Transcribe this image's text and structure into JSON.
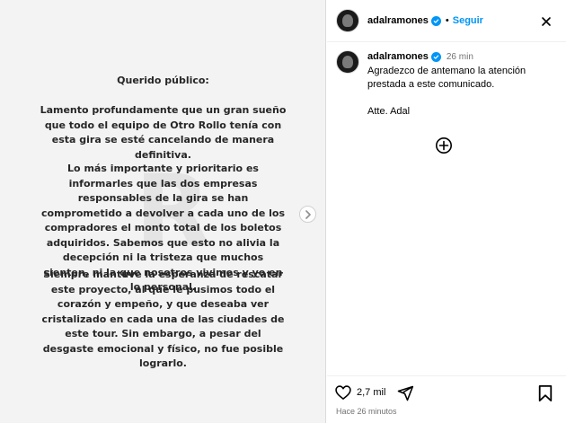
{
  "post": {
    "letter": {
      "greeting": "Querido público:",
      "paragraph1": "Lamento profundamente que un gran sueño que todo el equipo de Otro Rollo tenía con esta gira se esté cancelando de manera definitiva.",
      "paragraph2": "Lo más importante y prioritario es informarles que las dos empresas responsables de la gira se han comprometido a devolver a cada uno de los compradores el monto total de los boletos adquiridos. Sabemos que esto no alivia la decepción ni la tristeza que muchos sienten, ni la que nosotros vivimos y yo en lo personal.",
      "paragraph3": "Siempre mantuve la esperanza de rescatar este proyecto, al que le pusimos todo el corazón y empeño, y que deseaba ver cristalizado en cada una de las ciudades de este tour. Sin embargo, a pesar del desgaste emocional y físico, no fue posible lograrlo."
    },
    "watermark": "R"
  },
  "header": {
    "username": "adalramones",
    "separator": "•",
    "follow_label": "Seguir"
  },
  "caption": {
    "username": "adalramones",
    "time": "26 min",
    "text": "Agradezco de antemano la atención prestada a este comunicado.",
    "signature": "Atte. Adal"
  },
  "actions": {
    "like_count": "2,7 mil",
    "posted": "Hace 26 minutos"
  },
  "icons": {
    "verified": "verified-badge-icon",
    "more": "more-options-icon",
    "add": "add-comment-icon",
    "like": "heart-icon",
    "share": "share-icon",
    "save": "bookmark-icon",
    "next": "chevron-right-icon"
  },
  "colors": {
    "accent": "#0095f6",
    "muted": "#737373",
    "border": "#dbdbdb",
    "image_bg": "#f3f3f3"
  }
}
